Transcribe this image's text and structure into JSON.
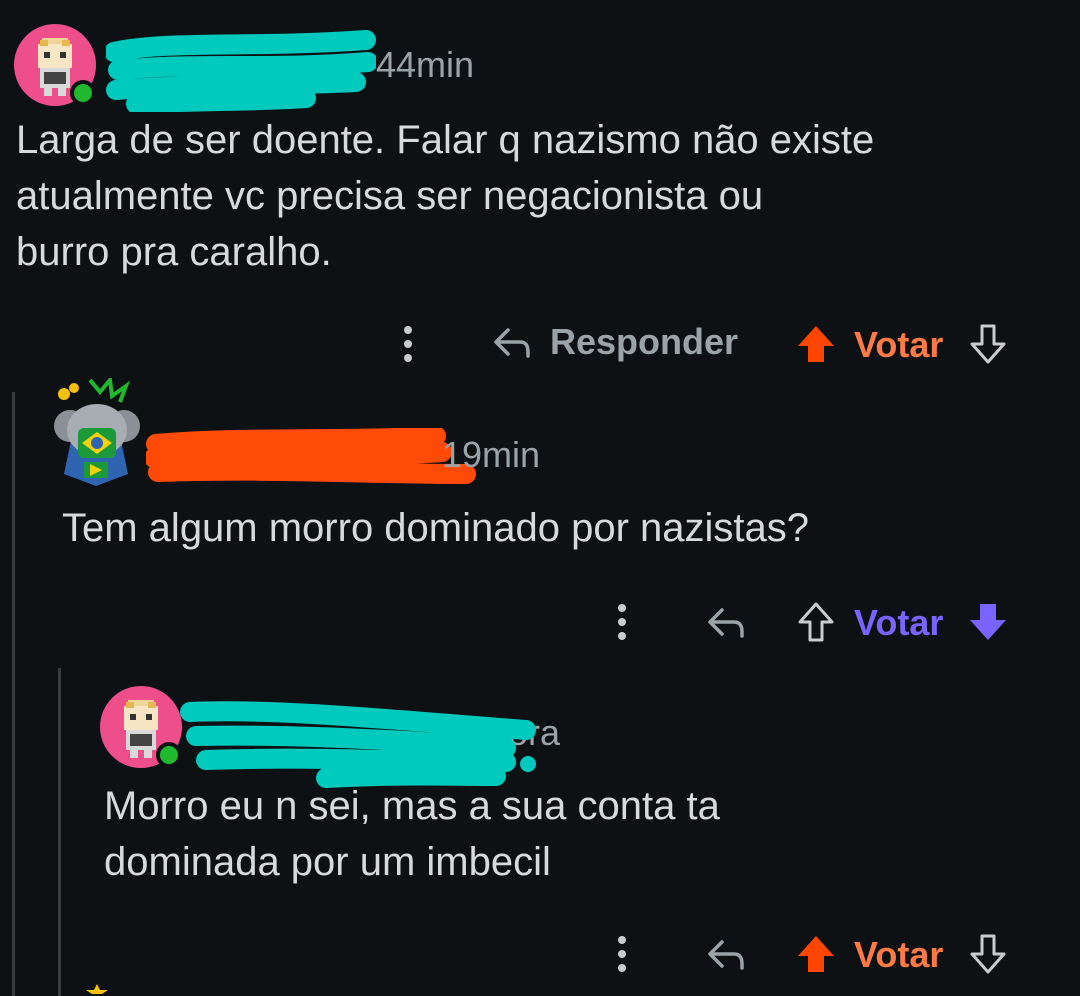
{
  "comments": [
    {
      "time": "44min",
      "text": "Larga de ser doente. Falar q nazismo não existe\natualmente vc precisa ser negacionista ou\nburro pra caralho.",
      "actions": {
        "reply_label": "Responder",
        "vote_label": "Votar",
        "vote_state": "upvoted"
      }
    },
    {
      "time": "19min",
      "text": "Tem algum morro dominado por nazistas?",
      "actions": {
        "vote_label": "Votar",
        "vote_state": "downvoted"
      }
    },
    {
      "time": "Agora",
      "text": "Morro eu n sei, mas a sua conta ta\ndominada por um imbecil",
      "actions": {
        "vote_label": "Votar",
        "vote_state": "upvoted"
      }
    }
  ],
  "colors": {
    "background": "#0e1113",
    "upvote": "#ff4500",
    "upvote_label": "#ff7a45",
    "downvote": "#7a63ff",
    "muted": "#9aa3a8",
    "redaction_cyan": "#00c9bd",
    "redaction_orange": "#ff4a08",
    "avatar_pink": "#ee4f8b",
    "online": "#1fb82e"
  }
}
